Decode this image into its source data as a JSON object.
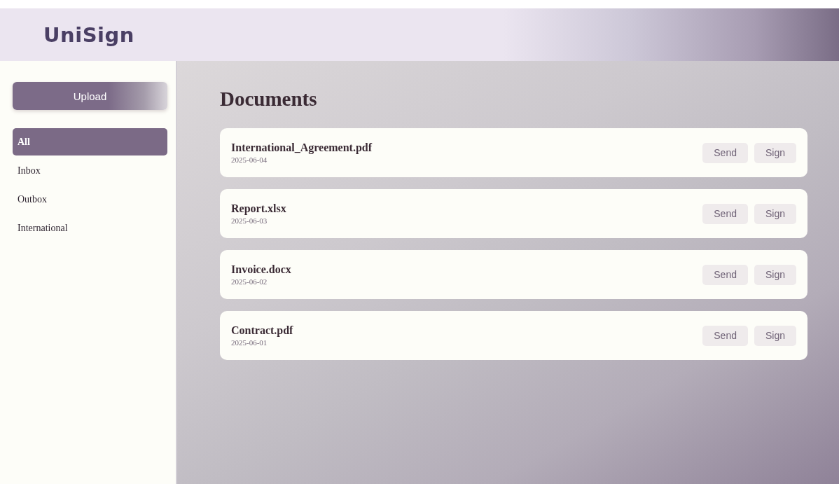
{
  "app": {
    "title": "UniSign"
  },
  "sidebar": {
    "upload_button": "Upload",
    "items": [
      {
        "label": "All",
        "selected": true
      },
      {
        "label": "Inbox",
        "selected": false
      },
      {
        "label": "Outbox",
        "selected": false
      },
      {
        "label": "International",
        "selected": false
      }
    ]
  },
  "main": {
    "title": "Documents",
    "documents": [
      {
        "name": "International_Agreement.pdf",
        "date": "2025-06-04",
        "actions": [
          "Send",
          "Sign"
        ]
      },
      {
        "name": "Report.xlsx",
        "date": "2025-06-03",
        "actions": [
          "Send",
          "Sign"
        ]
      },
      {
        "name": "Invoice.docx",
        "date": "2025-06-02",
        "actions": [
          "Send",
          "Sign"
        ]
      },
      {
        "name": "Contract.pdf",
        "date": "2025-06-01",
        "actions": [
          "Send",
          "Sign"
        ]
      }
    ]
  }
}
